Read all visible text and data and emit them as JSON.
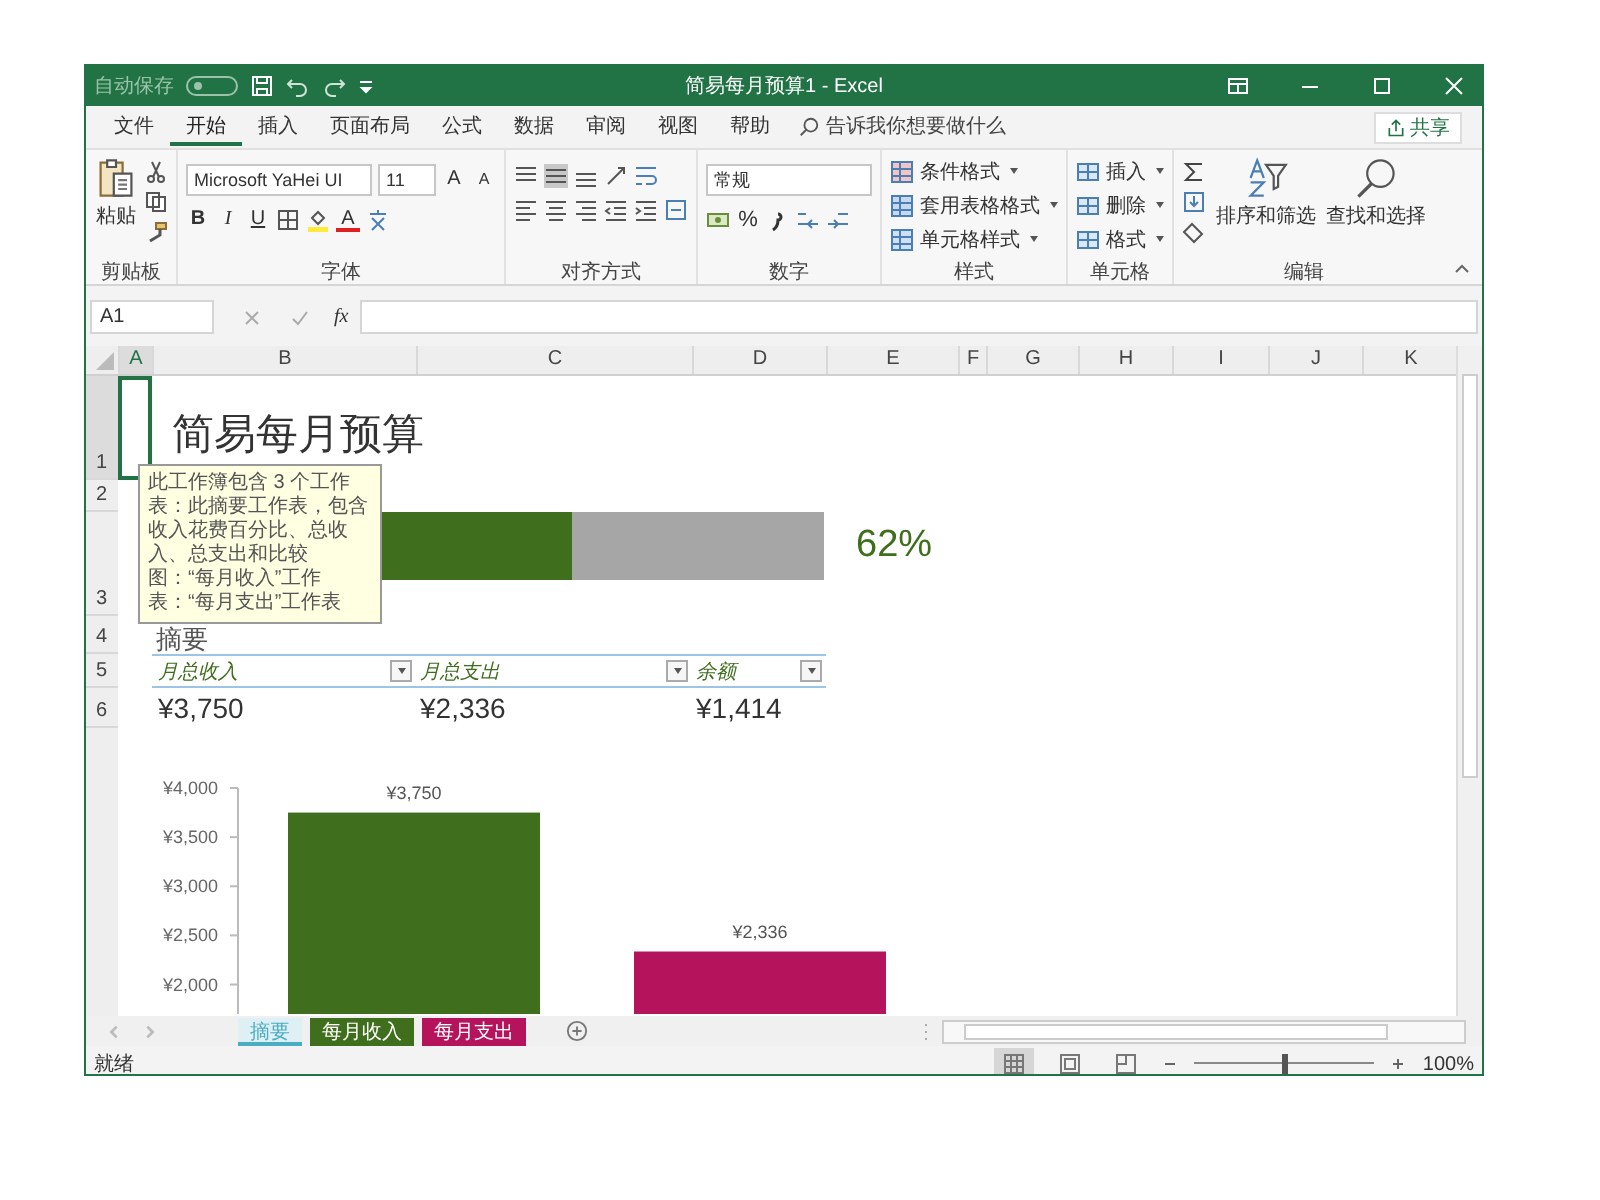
{
  "window": {
    "title": "简易每月预算1 - Excel",
    "autosave": {
      "label": "自动保存",
      "on": false
    }
  },
  "menu_tabs": [
    {
      "label": "文件",
      "selected": false
    },
    {
      "label": "开始",
      "selected": true
    },
    {
      "label": "插入",
      "selected": false
    },
    {
      "label": "页面布局",
      "selected": false
    },
    {
      "label": "公式",
      "selected": false
    },
    {
      "label": "数据",
      "selected": false
    },
    {
      "label": "审阅",
      "selected": false
    },
    {
      "label": "视图",
      "selected": false
    },
    {
      "label": "帮助",
      "selected": false
    }
  ],
  "tell_me": {
    "placeholder": "告诉我你想要做什么"
  },
  "share_button": "共享",
  "ribbon": {
    "clipboard": {
      "paste": "粘贴",
      "label": "剪贴板"
    },
    "font": {
      "name": "Microsoft YaHei UI",
      "size": "11",
      "grow": "A",
      "shrink": "A",
      "bold": "B",
      "italic": "I",
      "underline": "U",
      "font_color": "A",
      "label": "字体"
    },
    "alignment": {
      "label": "对齐方式"
    },
    "number": {
      "format": "常规",
      "percent": "%",
      "label": "数字"
    },
    "styles": {
      "items": [
        "条件格式",
        "套用表格格式",
        "单元格样式"
      ],
      "label": "样式"
    },
    "cells": {
      "items": [
        "插入",
        "删除",
        "格式"
      ],
      "label": "单元格"
    },
    "editing": {
      "sort": "排序和筛选",
      "find": "查找和选择",
      "label": "编辑"
    }
  },
  "formula_bar": {
    "name_box": "A1",
    "fx": "fx"
  },
  "columns": [
    "A",
    "B",
    "C",
    "D",
    "E",
    "F",
    "G",
    "H",
    "I",
    "J",
    "K"
  ],
  "rows": [
    "1",
    "2",
    "3",
    "4",
    "5",
    "6"
  ],
  "sheet": {
    "title": "简易每月预算",
    "tooltip": "此工作簿包含 3 个工作表：此摘要工作表，包含收入花费百分比、总收入、总支出和比较图：“每月收入”工作表：“每月支出”工作表",
    "income_bar": {
      "level": 0.62
    },
    "percent": "62%",
    "summary_heading": "摘要",
    "table": {
      "columns": [
        "月总收入",
        "月总支出",
        "余额"
      ],
      "values": [
        "¥3,750",
        "¥2,336",
        "¥1,414"
      ]
    },
    "chart_data": {
      "type": "bar",
      "values": [
        3750,
        2336
      ],
      "ylim": [
        1700,
        4000
      ],
      "colors": [
        "#3f6e1c",
        "#b5135b"
      ],
      "yticks": [
        {
          "value": 2000,
          "label": "¥2,000"
        },
        {
          "value": 2500,
          "label": "¥2,500"
        },
        {
          "value": 3000,
          "label": "¥3,000"
        },
        {
          "value": 3500,
          "label": "¥3,500"
        },
        {
          "value": 4000,
          "label": "¥4,000"
        }
      ],
      "value_labels": [
        "¥3,750",
        "¥2,336"
      ]
    }
  },
  "sheet_tabs": [
    {
      "label": "摘要",
      "selected": true,
      "color": "#4bacc6"
    },
    {
      "label": "每月收入",
      "selected": false,
      "color": "#3f6e1c"
    },
    {
      "label": "每月支出",
      "selected": false,
      "color": "#b5135b"
    }
  ],
  "status_bar": {
    "ready": "就绪",
    "zoom_slider": {
      "level": 0.5
    },
    "zoom": "100%"
  }
}
